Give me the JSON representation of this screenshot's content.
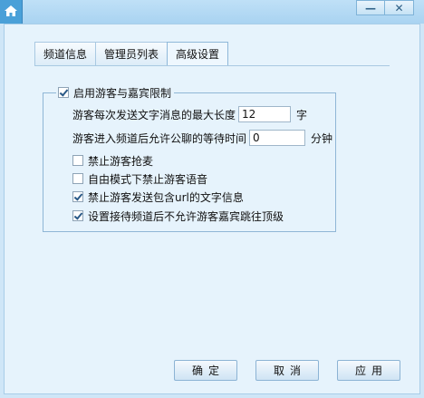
{
  "window": {
    "minimize_glyph": "—",
    "close_glyph": "✕"
  },
  "tabs": [
    {
      "label": "频道信息",
      "active": false
    },
    {
      "label": "管理员列表",
      "active": false
    },
    {
      "label": "高级设置",
      "active": true
    }
  ],
  "guest_limit": {
    "enable_label": "启用游客与嘉宾限制",
    "enabled": true,
    "max_length_label": "游客每次发送文字消息的最大长度",
    "max_length_value": "12",
    "max_length_unit": "字",
    "wait_time_label": "游客进入频道后允许公聊的等待时间",
    "wait_time_value": "0",
    "wait_time_unit": "分钟",
    "options": [
      {
        "label": "禁止游客抢麦",
        "checked": false
      },
      {
        "label": "自由模式下禁止游客语音",
        "checked": false
      },
      {
        "label": "禁止游客发送包含url的文字信息",
        "checked": true
      },
      {
        "label": "设置接待频道后不允许游客嘉宾跳往顶级",
        "checked": true
      }
    ]
  },
  "buttons": {
    "ok": "确定",
    "cancel": "取消",
    "apply": "应用"
  },
  "colors": {
    "background": "#cfe6f7",
    "frame": "#e6f3fc",
    "accent": "#4aa0d8"
  },
  "icons": {
    "title_icon": "home-icon"
  }
}
